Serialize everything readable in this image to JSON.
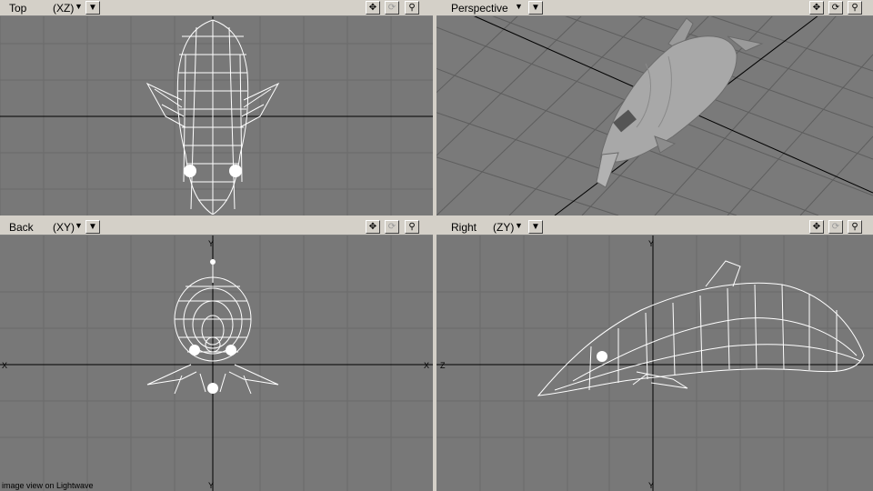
{
  "viewports": {
    "top": {
      "label": "Top",
      "axis": "(XZ)"
    },
    "perspective": {
      "label": "Perspective"
    },
    "back": {
      "label": "Back",
      "axis": "(XY)"
    },
    "right": {
      "label": "Right",
      "axis": "(ZY)"
    }
  },
  "controls": {
    "move_icon": "move-icon",
    "rotate_icon": "rotate-icon",
    "zoom_icon": "zoom-icon",
    "dropdown_icon": "chevron-down-icon"
  },
  "axes": {
    "x": "X",
    "y": "Y",
    "z": "Z"
  },
  "caption": "image view on Lightwave",
  "colors": {
    "viewport_bg": "#787878",
    "wire": "#ffffff",
    "grid": "#6a6a6a",
    "toolbar": "#d4d0c8"
  }
}
